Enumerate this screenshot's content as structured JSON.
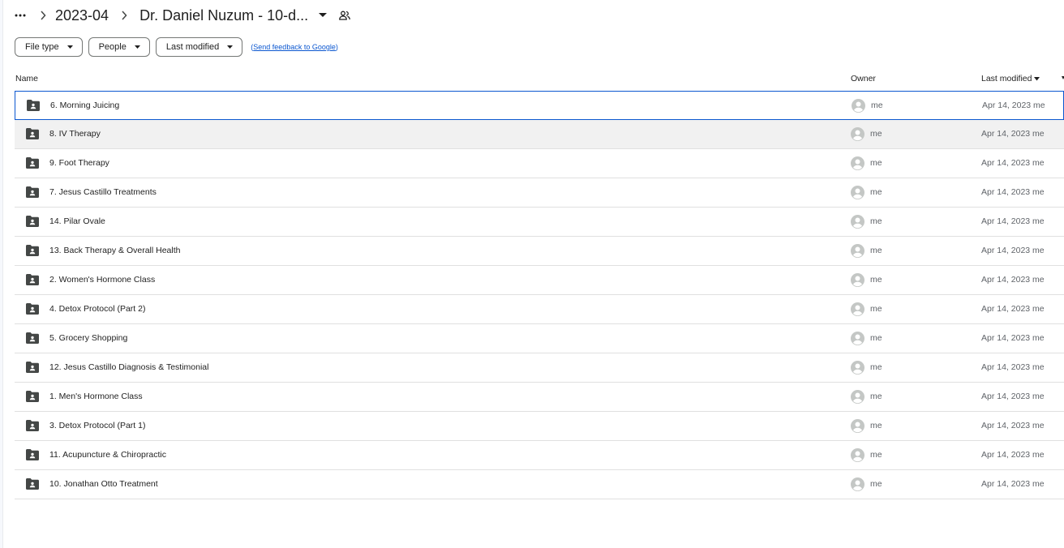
{
  "breadcrumb": {
    "parent": "2023-04",
    "current": "Dr. Daniel Nuzum - 10-d..."
  },
  "filters": {
    "file_type": "File type",
    "people": "People",
    "last_modified": "Last modified",
    "feedback": "Send feedback to Google"
  },
  "columns": {
    "name": "Name",
    "owner": "Owner",
    "last_modified": "Last modified"
  },
  "icons": {
    "more": "more-horiz-icon",
    "separator": "chevron-right-icon",
    "dropdown": "arrow-drop-down-icon",
    "shared": "people-icon",
    "folder": "shared-folder-icon",
    "avatar": "account-circle-icon",
    "sort": "arrow-down-icon"
  },
  "colors": {
    "accent": "#0b57d0",
    "folder": "#444746",
    "avatar": "#c4c7c5",
    "hover_row": "#f1f1f1"
  },
  "rows": [
    {
      "name": "6. Morning Juicing",
      "owner": "me",
      "modified": "Apr 14, 2023 me"
    },
    {
      "name": "8. IV Therapy",
      "owner": "me",
      "modified": "Apr 14, 2023 me"
    },
    {
      "name": "9. Foot Therapy",
      "owner": "me",
      "modified": "Apr 14, 2023 me"
    },
    {
      "name": "7. Jesus Castillo Treatments",
      "owner": "me",
      "modified": "Apr 14, 2023 me"
    },
    {
      "name": "14. Pilar Ovale",
      "owner": "me",
      "modified": "Apr 14, 2023 me"
    },
    {
      "name": "13. Back Therapy & Overall Health",
      "owner": "me",
      "modified": "Apr 14, 2023 me"
    },
    {
      "name": "2. Women's Hormone Class",
      "owner": "me",
      "modified": "Apr 14, 2023 me"
    },
    {
      "name": "4. Detox Protocol (Part 2)",
      "owner": "me",
      "modified": "Apr 14, 2023 me"
    },
    {
      "name": "5. Grocery Shopping",
      "owner": "me",
      "modified": "Apr 14, 2023 me"
    },
    {
      "name": "12. Jesus Castillo Diagnosis & Testimonial",
      "owner": "me",
      "modified": "Apr 14, 2023 me"
    },
    {
      "name": "1. Men's Hormone Class",
      "owner": "me",
      "modified": "Apr 14, 2023 me"
    },
    {
      "name": "3. Detox Protocol (Part 1)",
      "owner": "me",
      "modified": "Apr 14, 2023 me"
    },
    {
      "name": "11. Acupuncture & Chiropractic",
      "owner": "me",
      "modified": "Apr 14, 2023 me"
    },
    {
      "name": "10. Jonathan Otto Treatment",
      "owner": "me",
      "modified": "Apr 14, 2023 me"
    }
  ]
}
